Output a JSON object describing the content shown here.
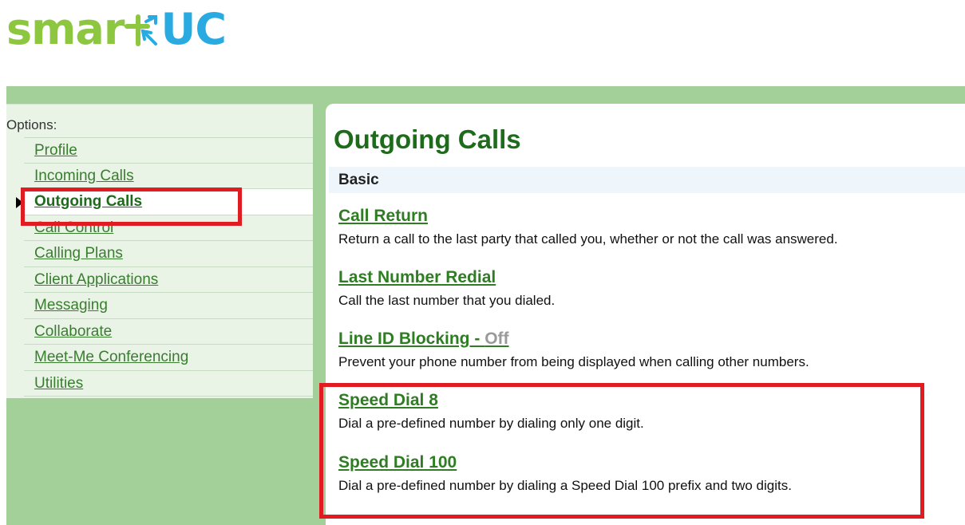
{
  "logo": {
    "part1": "smar",
    "part2": "UC"
  },
  "colors": {
    "brand_green": "#8dc63f",
    "brand_blue": "#29abe2",
    "nav_green": "#3a7d30",
    "highlight_red": "#e01b22"
  },
  "sidebar": {
    "title": "Options:",
    "items": [
      {
        "label": "Profile"
      },
      {
        "label": "Incoming Calls"
      },
      {
        "label": "Outgoing Calls",
        "active": true
      },
      {
        "label": "Call Control"
      },
      {
        "label": "Calling Plans"
      },
      {
        "label": "Client Applications"
      },
      {
        "label": "Messaging"
      },
      {
        "label": "Collaborate"
      },
      {
        "label": "Meet-Me Conferencing"
      },
      {
        "label": "Utilities"
      }
    ]
  },
  "main": {
    "title": "Outgoing Calls",
    "section": "Basic",
    "features": [
      {
        "name": "Call Return",
        "status": "",
        "desc": "Return a call to the last party that called you, whether or not the call was answered."
      },
      {
        "name": "Last Number Redial",
        "status": "",
        "desc": "Call the last number that you dialed."
      },
      {
        "name": "Line ID Blocking - ",
        "status": "Off",
        "desc": "Prevent your phone number from being displayed when calling other numbers."
      },
      {
        "name": "Speed Dial 8",
        "status": "",
        "desc": "Dial a pre-defined number by dialing only one digit."
      },
      {
        "name": "Speed Dial 100",
        "status": "",
        "desc": "Dial a pre-defined number by dialing a Speed Dial 100 prefix and two digits."
      }
    ]
  }
}
